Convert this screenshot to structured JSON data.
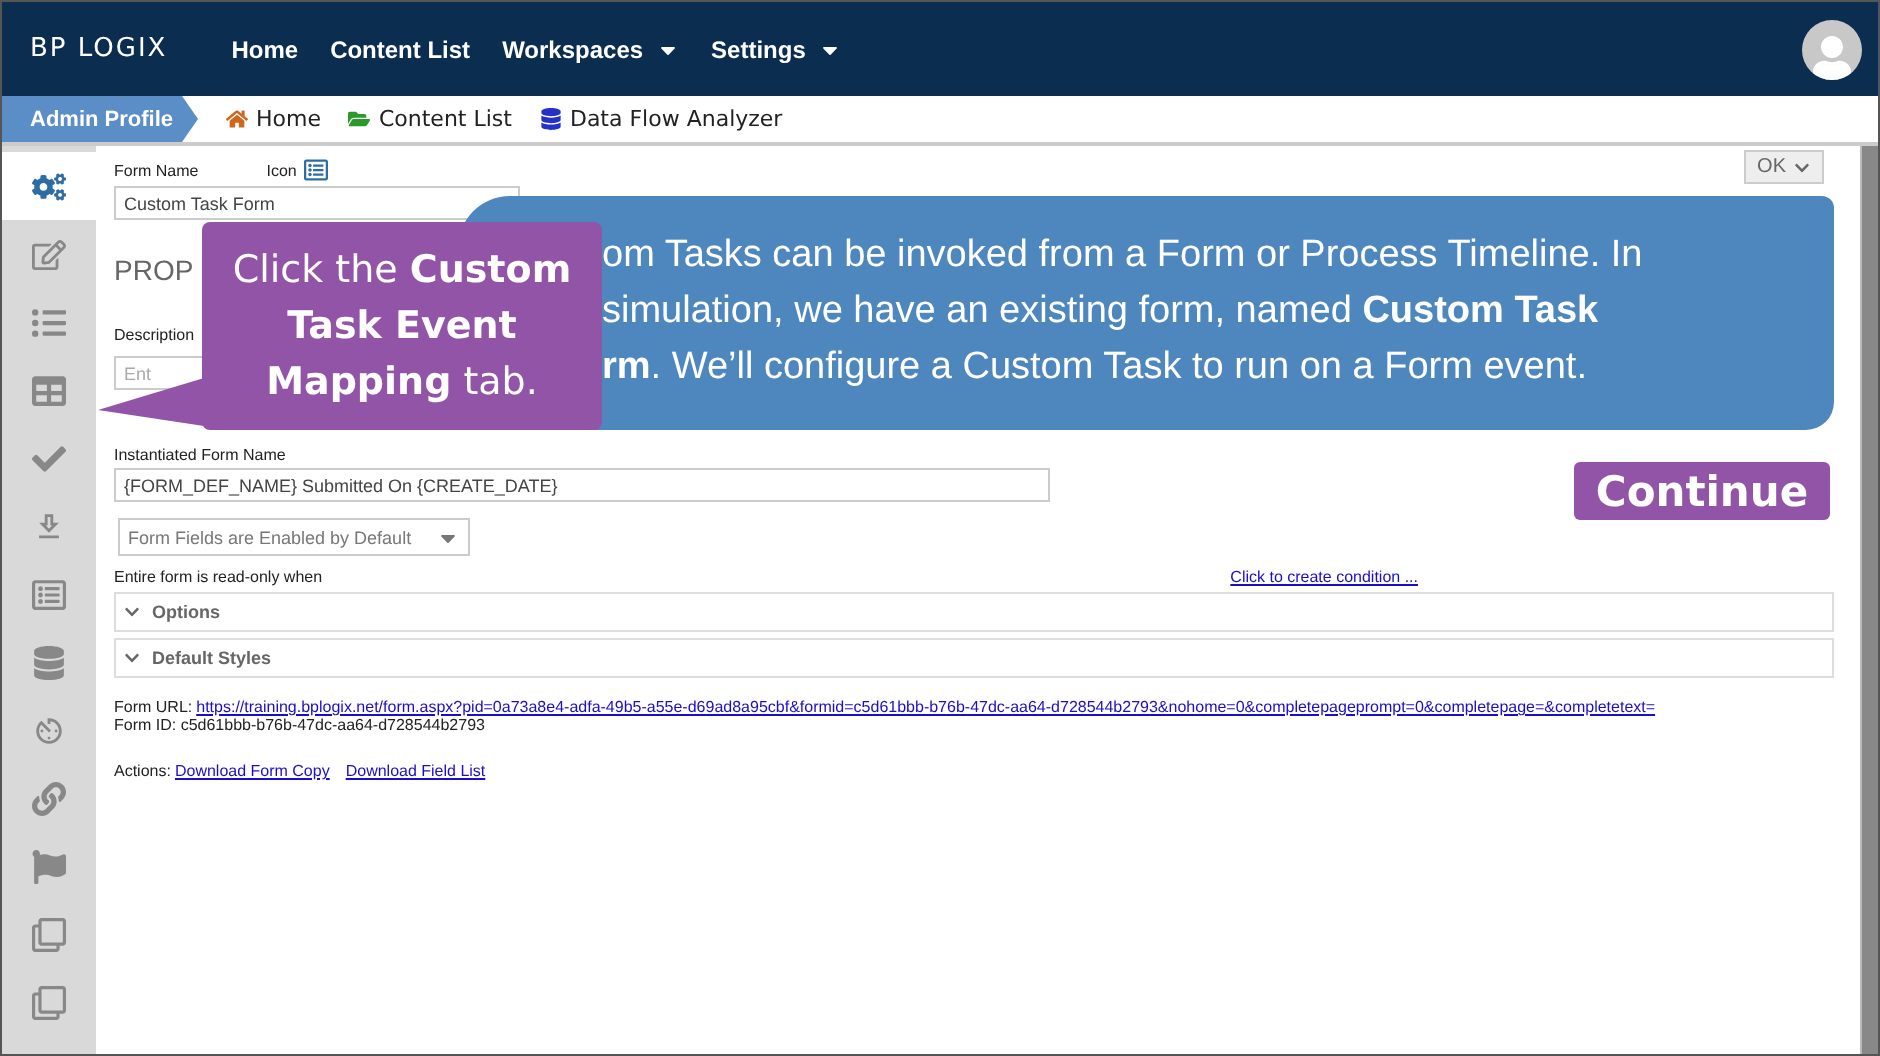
{
  "top_nav": {
    "logo": "BP LOGIX",
    "items": [
      {
        "label": "Home",
        "has_menu": false
      },
      {
        "label": "Content List",
        "has_menu": false
      },
      {
        "label": "Workspaces",
        "has_menu": true
      },
      {
        "label": "Settings",
        "has_menu": true
      }
    ]
  },
  "breadcrumb": {
    "profile": "Admin Profile",
    "links": [
      "Home",
      "Content List",
      "Data Flow Analyzer"
    ]
  },
  "sidebar": {
    "items": [
      {
        "selected": true
      },
      {
        "selected": false
      },
      {
        "selected": false
      },
      {
        "selected": false
      },
      {
        "selected": false
      },
      {
        "selected": false
      },
      {
        "selected": false
      },
      {
        "selected": false
      },
      {
        "selected": false
      },
      {
        "selected": false
      },
      {
        "selected": false
      },
      {
        "selected": false
      },
      {
        "selected": false
      }
    ]
  },
  "ok_button": "OK",
  "form": {
    "name_label": "Form Name",
    "icon_label": "Icon",
    "name_value": "Custom Task Form",
    "heading": "PROP",
    "description_label": "Description",
    "description_placeholder": "Ent",
    "instantiated_label": "Instantiated Form Name",
    "instantiated_value": "{FORM_DEF_NAME} Submitted On {CREATE_DATE}",
    "fields_dropdown": "Form Fields are Enabled by Default",
    "readonly_label": "Entire form is read-only when",
    "condition_link": "Click to create condition ...",
    "sections": [
      {
        "label": "Options"
      },
      {
        "label": "Default Styles"
      }
    ],
    "url_label": "Form URL:",
    "url": "https://training.bplogix.net/form.aspx?pid=0a73a8e4-adfa-49b5-a55e-d69ad8a95cbf&formid=c5d61bbb-b76b-47dc-aa64-d728544b2793&nohome=0&completepageprompt=0&completepage=&completetext=",
    "form_id": "Form ID: c5d61bbb-b76b-47dc-aa64-d728544b2793",
    "actions_label": "Actions:",
    "actions": [
      "Download Form Copy",
      "Download Field List"
    ]
  },
  "callout_hint": "Click the **Custom Task Event Mapping** tab.",
  "callout_info": {
    "lines": [
      "om Tasks can be invoked from a Form or Process Timeline. In",
      "simulation, we have an existing form, named **Custom Task**",
      "**rm**. We’ll configure a Custom Task to run on a Form event."
    ]
  },
  "continue_button": "Continue"
}
